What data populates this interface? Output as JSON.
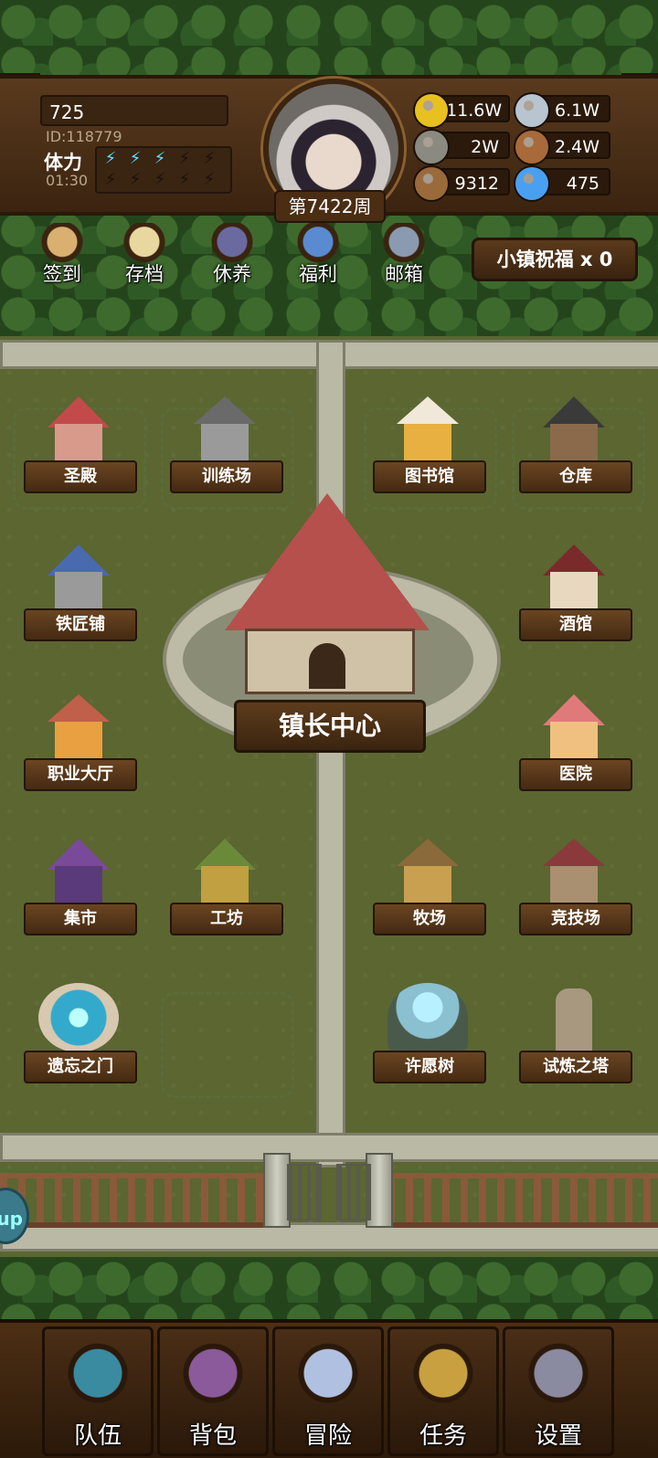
{
  "player": {
    "name": "725",
    "id": "ID:118779",
    "stamina_label": "体力",
    "stamina_timer": "01:30",
    "stamina_filled": 3,
    "stamina_total": 5,
    "week": "第7422周"
  },
  "resources": [
    {
      "name": "gold-coin-icon",
      "value": "911.6W",
      "color": "#e8c020"
    },
    {
      "name": "iron-ingot-icon",
      "value": "6.1W",
      "color": "#b8c4d0"
    },
    {
      "name": "stone-ore-icon",
      "value": "2W",
      "color": "#8a8a80"
    },
    {
      "name": "leather-icon",
      "value": "2.4W",
      "color": "#a86a3a"
    },
    {
      "name": "wood-log-icon",
      "value": "9312",
      "color": "#9a6a3a"
    },
    {
      "name": "crystal-icon",
      "value": "475",
      "color": "#4aa0f0"
    }
  ],
  "menu": [
    {
      "label": "签到",
      "icon": "quill-checkin-icon",
      "color": "#d9b070"
    },
    {
      "label": "存档",
      "icon": "scroll-save-icon",
      "color": "#e8d8a0"
    },
    {
      "label": "休养",
      "icon": "rest-sign-icon",
      "color": "#6a6aa0"
    },
    {
      "label": "福利",
      "icon": "welfare-wheel-icon",
      "color": "#5a8ad0"
    },
    {
      "label": "邮箱",
      "icon": "mailbox-icon",
      "color": "#8a9ab0"
    }
  ],
  "blessing": "小镇祝福 x 0",
  "buildings": {
    "holy_temple": "圣殿",
    "training_ground": "训练场",
    "library": "图书馆",
    "warehouse": "仓库",
    "blacksmith": "铁匠铺",
    "tavern": "酒馆",
    "job_hall": "职业大厅",
    "hospital": "医院",
    "market": "集市",
    "workshop": "工坊",
    "ranch": "牧场",
    "arena": "竞技场",
    "forgotten_gate": "遗忘之门",
    "wishing_tree": "许愿树",
    "trial_tower": "试炼之塔",
    "mayor_center": "镇长中心"
  },
  "side_tab": "up",
  "tabs": [
    {
      "label": "队伍",
      "icon": "helmet-team-icon",
      "color": "#3a8aa0"
    },
    {
      "label": "背包",
      "icon": "backpack-icon",
      "color": "#8a5a9a"
    },
    {
      "label": "冒险",
      "icon": "crossed-swords-icon",
      "color": "#b0c0e0"
    },
    {
      "label": "任务",
      "icon": "quest-scroll-icon",
      "color": "#c8a040"
    },
    {
      "label": "设置",
      "icon": "gear-settings-icon",
      "color": "#8a8aa0"
    }
  ]
}
